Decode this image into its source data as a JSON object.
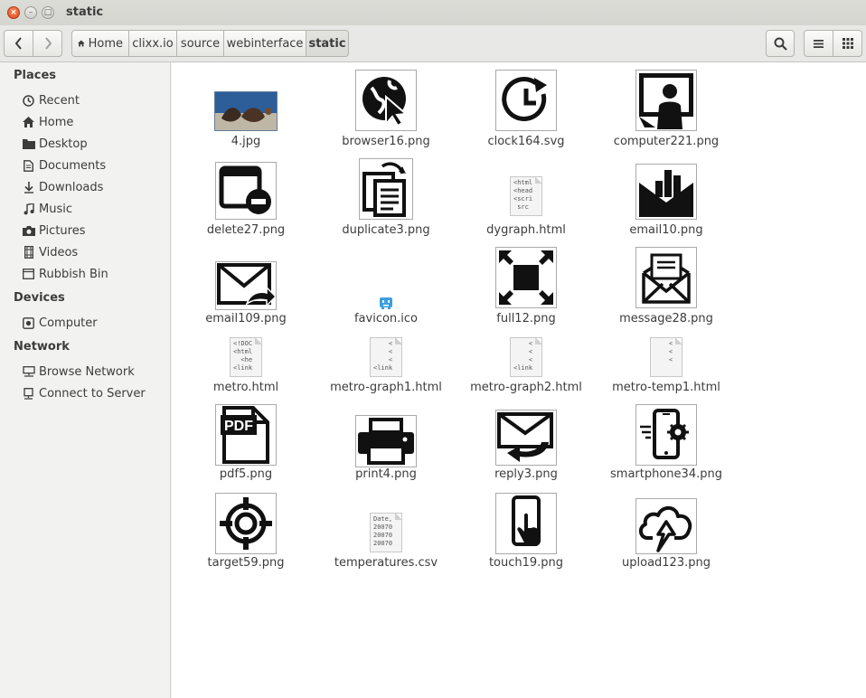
{
  "window": {
    "title": "static"
  },
  "toolbar": {
    "back_icon": "chevron-left-icon",
    "forward_icon": "chevron-right-icon",
    "breadcrumbs": [
      "Home",
      "clixx.io",
      "source",
      "webinterface",
      "static"
    ],
    "search_icon": "search-icon",
    "list_icon": "list-view-icon",
    "grid_icon": "grid-view-icon"
  },
  "sidebar": {
    "places_heading": "Places",
    "places": [
      {
        "label": "Recent",
        "icon": "clock-icon"
      },
      {
        "label": "Home",
        "icon": "home-icon"
      },
      {
        "label": "Desktop",
        "icon": "folder-icon"
      },
      {
        "label": "Documents",
        "icon": "document-icon"
      },
      {
        "label": "Downloads",
        "icon": "download-icon"
      },
      {
        "label": "Music",
        "icon": "music-icon"
      },
      {
        "label": "Pictures",
        "icon": "camera-icon"
      },
      {
        "label": "Videos",
        "icon": "film-icon"
      },
      {
        "label": "Rubbish Bin",
        "icon": "trash-icon"
      }
    ],
    "devices_heading": "Devices",
    "devices": [
      {
        "label": "Computer",
        "icon": "drive-icon"
      }
    ],
    "network_heading": "Network",
    "network": [
      {
        "label": "Browse Network",
        "icon": "network-icon"
      },
      {
        "label": "Connect to Server",
        "icon": "server-icon"
      }
    ]
  },
  "files": [
    {
      "name": "4.jpg"
    },
    {
      "name": "browser16.png"
    },
    {
      "name": "clock164.svg"
    },
    {
      "name": "computer221.png"
    },
    {
      "name": "delete27.png"
    },
    {
      "name": "duplicate3.png"
    },
    {
      "name": "dygraph.html",
      "preview": "<html\n<head\n<scri\n src"
    },
    {
      "name": "email10.png"
    },
    {
      "name": "email109.png"
    },
    {
      "name": "favicon.ico"
    },
    {
      "name": "full12.png"
    },
    {
      "name": "message28.png"
    },
    {
      "name": "metro.html",
      "preview": "<!DOC\n<html\n  <he\n<link"
    },
    {
      "name": "metro-graph1.html",
      "preview": "    <\n    <\n    <\n<link"
    },
    {
      "name": "metro-graph2.html",
      "preview": "    <\n    <\n    <\n<link"
    },
    {
      "name": "metro-temp1.html",
      "preview": "    <\n    <\n    <"
    },
    {
      "name": "pdf5.png",
      "badge": "PDF"
    },
    {
      "name": "print4.png"
    },
    {
      "name": "reply3.png"
    },
    {
      "name": "smartphone34.png"
    },
    {
      "name": "target59.png"
    },
    {
      "name": "temperatures.csv",
      "preview": "Date,\n20070\n20070\n20070"
    },
    {
      "name": "touch19.png"
    },
    {
      "name": "upload123.png"
    }
  ]
}
